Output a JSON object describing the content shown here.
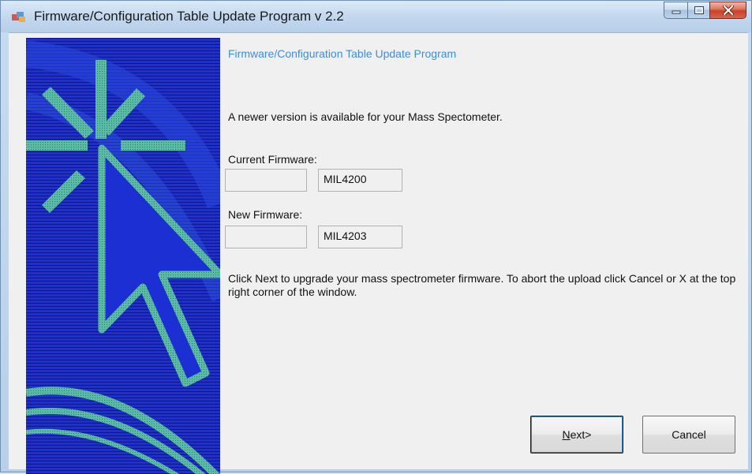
{
  "window": {
    "title": "Firmware/Configuration Table Update Program v 2.2",
    "icon": "app-window-icon"
  },
  "content": {
    "heading": "Firmware/Configuration Table Update Program",
    "intro": "A newer version is available for your Mass Spectometer.",
    "current_firmware": {
      "label": "Current  Firmware:",
      "left_value": "",
      "value": "MIL4200"
    },
    "new_firmware": {
      "label": "New Firmware:",
      "left_value": "",
      "value": "MIL4203"
    },
    "instructions": "Click Next to upgrade your mass spectrometer firmware. To abort the upload click Cancel or X at the top right corner of the window."
  },
  "buttons": {
    "next_accel": "N",
    "next_rest": "ext>",
    "cancel": "Cancel"
  },
  "colors": {
    "heading": "#3c8de0",
    "banner_blue": "#1a2fd1",
    "banner_teal": "#57b9a4"
  }
}
